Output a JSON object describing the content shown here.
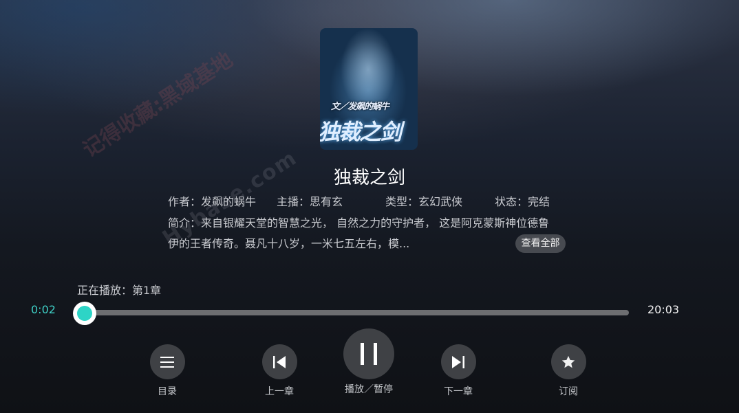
{
  "book": {
    "cover_alt_subtitle": "文／发飙的蜗牛",
    "cover_alt_title": "独裁之剑",
    "title": "独裁之剑",
    "author_label": "作者：发飙的蜗牛",
    "narrator_label": "主播：思有玄",
    "genre_label": "类型：玄幻武侠",
    "status_label": "状态：完结",
    "description_line1": "简介：来自银耀天堂的智慧之光， 自然之力的守护者， 这是阿克蒙斯神位德鲁",
    "description_line2": "伊的王者传奇。聂凡十八岁，一米七五左右，模...",
    "view_all_label": "查看全部"
  },
  "player": {
    "now_playing": "正在播放：第1章",
    "current_time": "0:02",
    "total_time": "20:03",
    "progress_fraction": 0.0017,
    "accent_color": "#2dd4c6",
    "controls": [
      {
        "id": "catalog",
        "icon": "menu-icon",
        "label": "目录"
      },
      {
        "id": "prev",
        "icon": "skip-previous-icon",
        "label": "上一章"
      },
      {
        "id": "play-pause",
        "icon": "pause-icon",
        "label": "播放／暂停"
      },
      {
        "id": "next",
        "icon": "skip-next-icon",
        "label": "下一章"
      },
      {
        "id": "subscribe",
        "icon": "star-icon",
        "label": "订阅"
      }
    ]
  },
  "watermark": {
    "line1": "记得收藏:黑域基地",
    "line2": "Hybase.com"
  }
}
